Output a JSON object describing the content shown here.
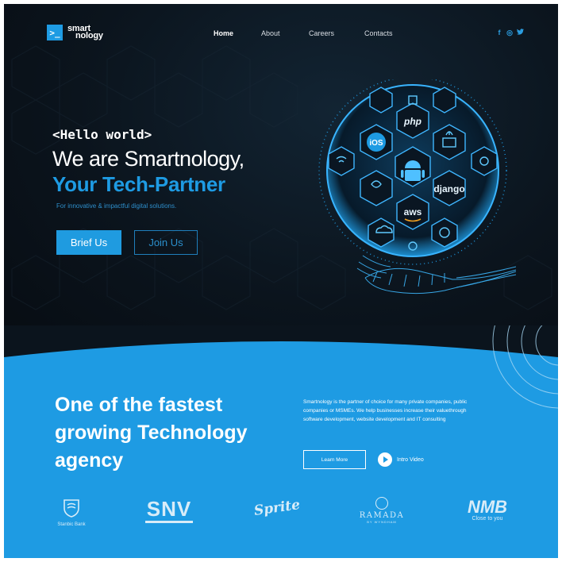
{
  "brand": {
    "logo_mark": ">_",
    "name_line1": "smart",
    "name_line2": "nology"
  },
  "nav": {
    "items": [
      {
        "label": "Home",
        "active": true
      },
      {
        "label": "About",
        "active": false
      },
      {
        "label": "Careers",
        "active": false
      },
      {
        "label": "Contacts",
        "active": false
      }
    ]
  },
  "social": {
    "facebook": "f",
    "instagram": "◎",
    "twitter": "🐦"
  },
  "hero": {
    "greeting": "<Hello world>",
    "headline": "We are Smartnology,",
    "headline_accent": "Your Tech-Partner",
    "tagline": "For innovative & impactful digital solutions.",
    "primary_button": "Brief Us",
    "secondary_button": "Join Us"
  },
  "globe": {
    "tiles": [
      "php",
      "iOS",
      "django",
      "aws"
    ],
    "icons": [
      "html5-icon",
      "laptop-icon",
      "java-icon",
      "at-icon",
      "android-icon",
      "python-icon",
      "wifi-icon",
      "cloud-icon",
      "wordpress-icon",
      "tablet-icon",
      "chrome-icon",
      "ie-icon"
    ]
  },
  "about": {
    "title": "One of the fastest growing Technology agency",
    "description": "Smartnology is the partner of choice for many private companies, public companies or MSMEs. We help businesses increase their valuethrough software development, website development and IT consulting",
    "learn_more": "Learn More",
    "video_label": "Intro Video"
  },
  "partners": [
    {
      "name": "Stanbic Bank"
    },
    {
      "name": "SNV"
    },
    {
      "name": "Sprite"
    },
    {
      "name": "RAMADA",
      "sub": "BY WYNDHAM"
    },
    {
      "name": "NMB",
      "sub": "Close to you"
    }
  ],
  "colors": {
    "accent": "#1e9be3",
    "dark": "#0b141d"
  }
}
